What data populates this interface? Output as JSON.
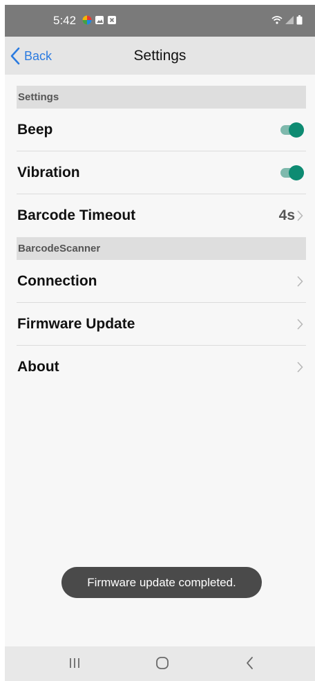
{
  "status_bar": {
    "time": "5:42",
    "icons": [
      "colorful-app-icon",
      "image-icon",
      "x-box-icon",
      "wifi-icon",
      "signal-icon",
      "battery-icon"
    ]
  },
  "nav": {
    "back_label": "Back",
    "title": "Settings"
  },
  "sections": [
    {
      "header": "Settings",
      "items": [
        {
          "label": "Beep",
          "control": "toggle",
          "on": true
        },
        {
          "label": "Vibration",
          "control": "toggle",
          "on": true
        },
        {
          "label": "Barcode Timeout",
          "control": "value",
          "value": "4s"
        }
      ]
    },
    {
      "header": "BarcodeScanner",
      "items": [
        {
          "label": "Connection",
          "control": "chevron"
        },
        {
          "label": "Firmware Update",
          "control": "chevron"
        },
        {
          "label": "About",
          "control": "chevron"
        }
      ]
    }
  ],
  "toast": {
    "message": "Firmware update completed."
  },
  "system_nav": {
    "buttons": [
      "recents-icon",
      "home-icon",
      "back-icon"
    ]
  },
  "colors": {
    "accent": "#2b7be0",
    "toggle_on": "#0e8b72",
    "status_bar": "#7a7a7a"
  }
}
